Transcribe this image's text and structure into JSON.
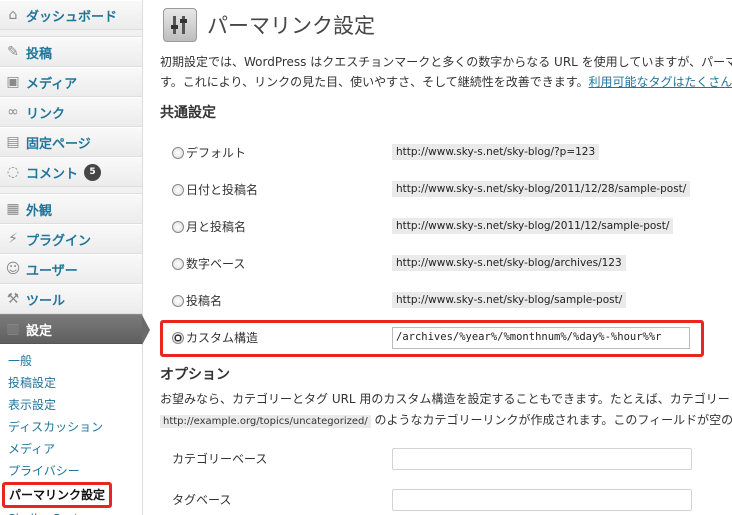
{
  "sidebar": {
    "items": [
      {
        "label": "ダッシュボード",
        "icon": "dashboard-icon",
        "glyph": "⌂"
      },
      {
        "label": "投稿",
        "icon": "pin-icon",
        "glyph": "✎"
      },
      {
        "label": "メディア",
        "icon": "media-icon",
        "glyph": "▣"
      },
      {
        "label": "リンク",
        "icon": "link-icon",
        "glyph": "∞"
      },
      {
        "label": "固定ページ",
        "icon": "pages-icon",
        "glyph": "▤"
      },
      {
        "label": "コメント",
        "icon": "comment-icon",
        "glyph": "◌",
        "badge": "5"
      },
      {
        "label": "外観",
        "icon": "appearance-icon",
        "glyph": "▦"
      },
      {
        "label": "プラグイン",
        "icon": "plugin-icon",
        "glyph": "⚡"
      },
      {
        "label": "ユーザー",
        "icon": "users-icon",
        "glyph": "☺"
      },
      {
        "label": "ツール",
        "icon": "tools-icon",
        "glyph": "⚒"
      },
      {
        "label": "設定",
        "icon": "settings-icon",
        "glyph": "▥"
      }
    ],
    "submenu": [
      "一般",
      "投稿設定",
      "表示設定",
      "ディスカッション",
      "メディア",
      "プライバシー",
      "パーマリンク設定",
      "Similar Posts"
    ]
  },
  "page": {
    "title": "パーマリンク設定",
    "intro_line1": "初期設定では、WordPress はクエスチョンマークと多くの数字からなる URL を使用していますが、パーマ",
    "intro_line2": "す。これにより、リンクの見た目、使いやすさ、そして継続性を改善できます。",
    "intro_link": "利用可能なタグはたくさん"
  },
  "common_settings": {
    "title": "共通設定",
    "options": [
      {
        "label": "デフォルト",
        "url": "http://www.sky-s.net/sky-blog/?p=123"
      },
      {
        "label": "日付と投稿名",
        "url": "http://www.sky-s.net/sky-blog/2011/12/28/sample-post/"
      },
      {
        "label": "月と投稿名",
        "url": "http://www.sky-s.net/sky-blog/2011/12/sample-post/"
      },
      {
        "label": "数字ベース",
        "url": "http://www.sky-s.net/sky-blog/archives/123"
      },
      {
        "label": "投稿名",
        "url": "http://www.sky-s.net/sky-blog/sample-post/"
      }
    ],
    "custom": {
      "label": "カスタム構造",
      "value": "/archives/%year%/%monthnum%/%day%-%hour%%r"
    }
  },
  "options_section": {
    "title": "オプション",
    "text_line1": "お望みなら、カテゴリーとタグ URL 用のカスタム構造を設定することもできます。たとえば、カテゴリー",
    "code": "http://example.org/topics/uncategorized/",
    "text_line2": " のようなカテゴリーリンクが作成されます。このフィールドが空の場",
    "category_base_label": "カテゴリーベース",
    "tag_base_label": "タグベース"
  },
  "colors": {
    "link": "#21759b",
    "highlight": "#e8261f"
  }
}
